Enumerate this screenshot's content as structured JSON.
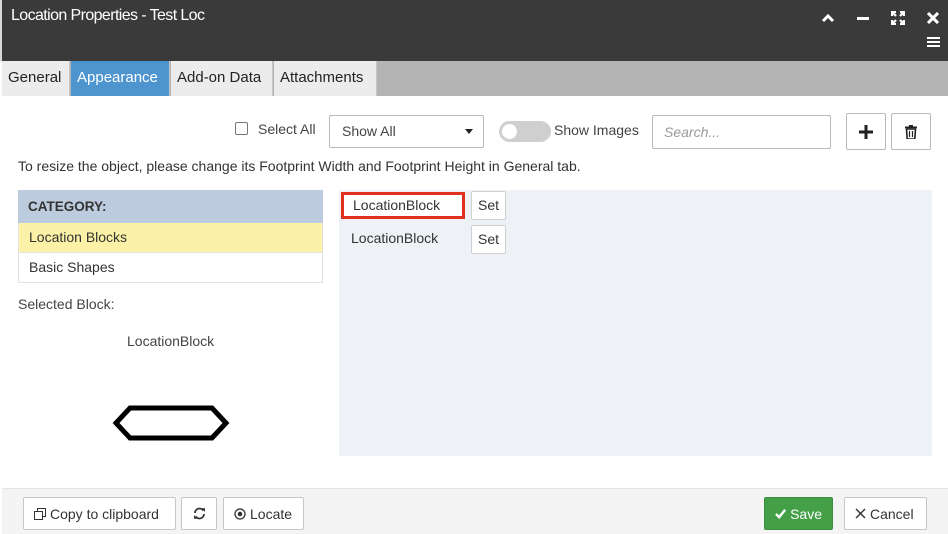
{
  "window": {
    "title": "Location Properties - Test Loc",
    "controls": [
      "collapse-icon",
      "minimize-icon",
      "fullscreen-icon",
      "close-icon",
      "menu-icon"
    ]
  },
  "tabs": [
    {
      "label": "General",
      "active": false
    },
    {
      "label": "Appearance",
      "active": true
    },
    {
      "label": "Add-on Data",
      "active": false
    },
    {
      "label": "Attachments",
      "active": false
    }
  ],
  "toolbar": {
    "select_all_label": "Select All",
    "select_all_checked": false,
    "filter_value": "Show All",
    "show_images_label": "Show Images",
    "show_images_on": false,
    "search_placeholder": "Search...",
    "add_icon": "plus-icon",
    "delete_icon": "trash-icon"
  },
  "info_text": "To resize the object, please change its Footprint Width and Footprint Height in General tab.",
  "category": {
    "header": "CATEGORY:",
    "items": [
      {
        "label": "Location Blocks",
        "active": true
      },
      {
        "label": "Basic Shapes",
        "active": false
      }
    ]
  },
  "selected_block": {
    "label": "Selected Block:",
    "name": "LocationBlock",
    "preview_icon": "hexagon-shape-icon"
  },
  "blocks": [
    {
      "name": "LocationBlock",
      "set_label": "Set",
      "selected": true
    },
    {
      "name": "LocationBlock",
      "set_label": "Set",
      "selected": false
    }
  ],
  "footer": {
    "copy_label": "Copy to clipboard",
    "refresh_icon": "refresh-icon",
    "locate_label": "Locate",
    "save_label": "Save",
    "cancel_label": "Cancel"
  },
  "colors": {
    "titlebar": "#3a3a3a",
    "active_tab": "#4e95cf",
    "category_header": "#bccbdd",
    "active_category": "#fbf2a8",
    "selected_outline": "#e2301f",
    "save": "#43a047"
  }
}
